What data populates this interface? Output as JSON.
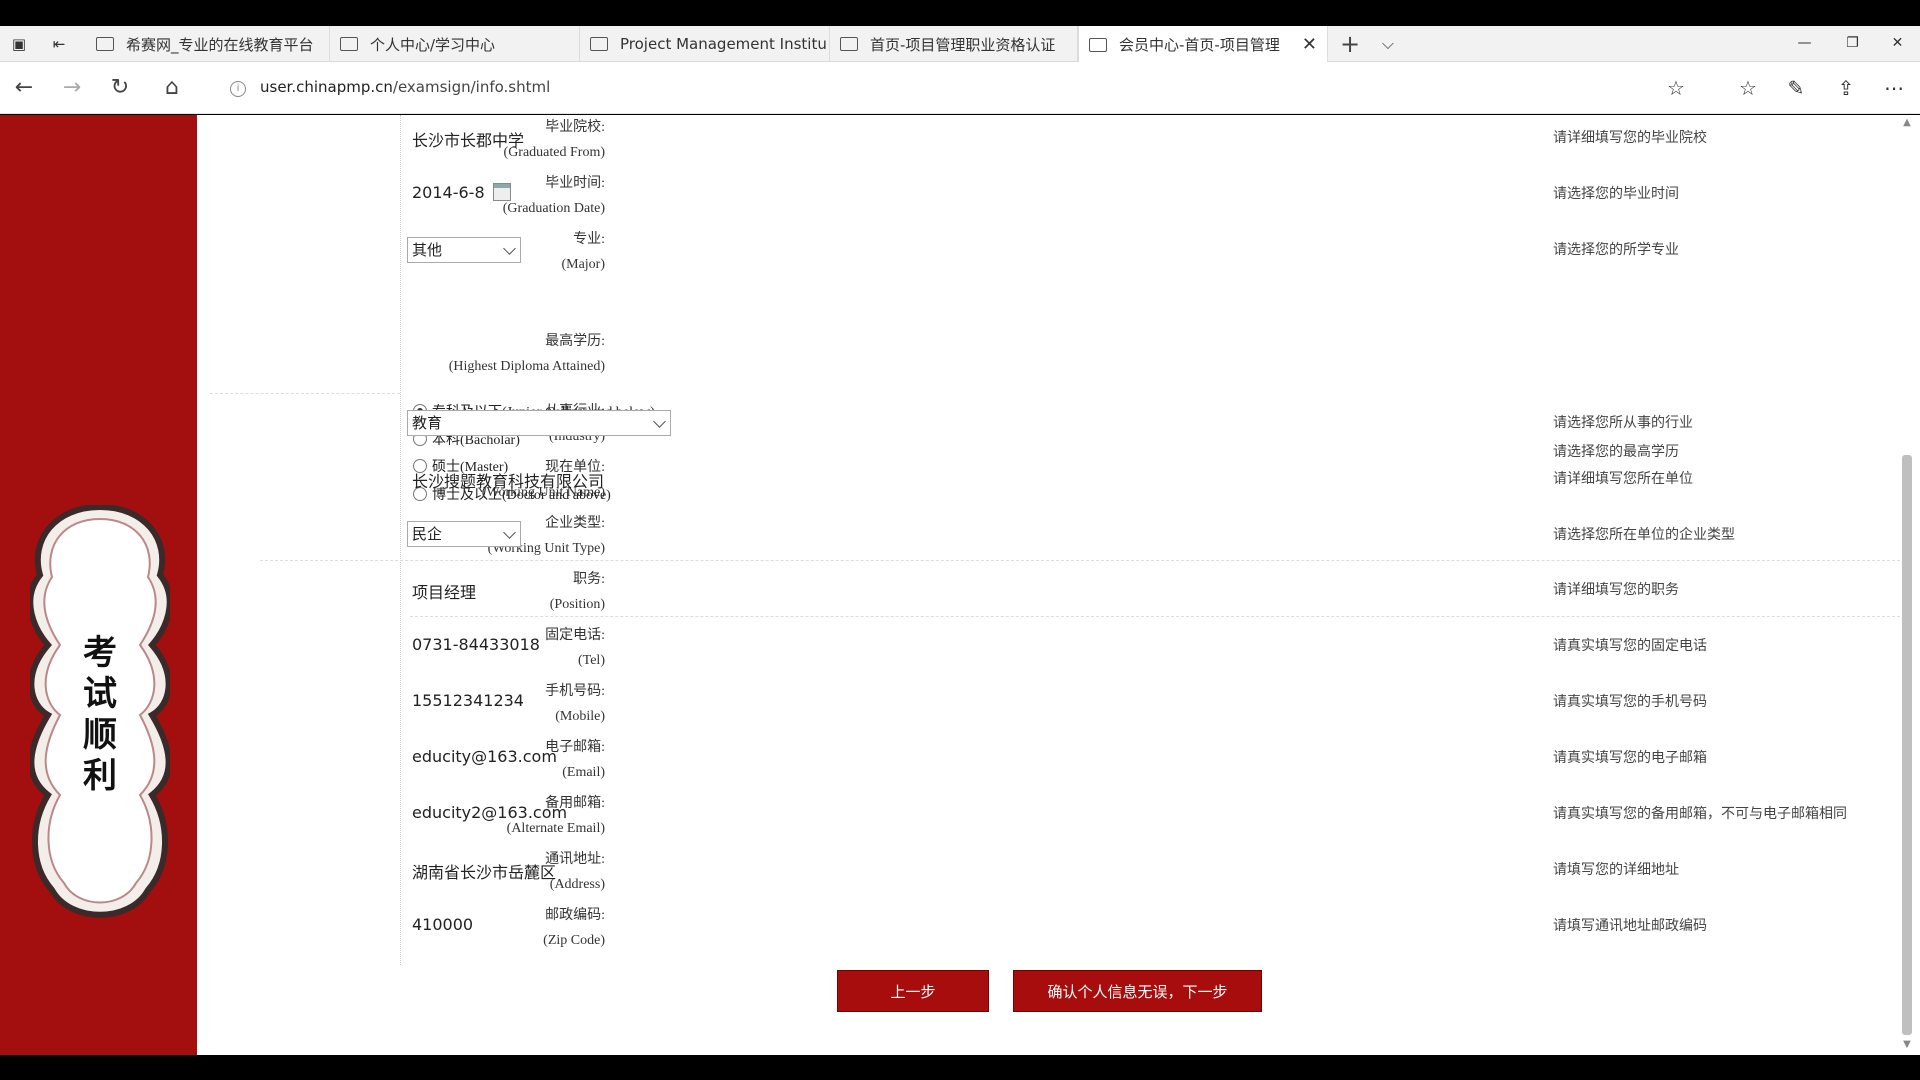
{
  "browser": {
    "tabs": [
      {
        "label": "希赛网_专业的在线教育平台"
      },
      {
        "label": "个人中心/学习中心"
      },
      {
        "label": "Project Management Institu"
      },
      {
        "label": "首页-项目管理职业资格认证"
      },
      {
        "label": "会员中心-首页-项目管理"
      }
    ],
    "new_tab": "+",
    "url_host": "user.chinapmp.cn",
    "url_path": "/examsign/info.shtml"
  },
  "sidebar": {
    "badge_chars": [
      "考",
      "试",
      "顺",
      "利"
    ],
    "brand_color": "#a30e0e"
  },
  "form": {
    "school": {
      "label_cn": "毕业院校:",
      "label_en": "(Graduated From)",
      "value": "长沙市长郡中学",
      "hint": "请详细填写您的毕业院校"
    },
    "grad_date": {
      "label_cn": "毕业时间:",
      "label_en": "(Graduation Date)",
      "value": "2014-6-8",
      "hint": "请选择您的毕业时间"
    },
    "major": {
      "label_cn": "专业:",
      "label_en": "(Major)",
      "value": "其他",
      "hint": "请选择您的所学专业"
    },
    "diploma": {
      "label_cn": "最高学历:",
      "label_en": "(Highest Diploma Attained)",
      "options": [
        "专科及以下(Junior College and below)",
        "本科(Bacholar)",
        "硕士(Master)",
        "博士及以上(Doctor and above)"
      ],
      "selected_index": 0,
      "hint": "请选择您的最高学历"
    },
    "industry": {
      "label_cn": "从事行业:",
      "label_en": "(Industry)",
      "value": "教育",
      "hint": "请选择您所从事的行业"
    },
    "work_unit": {
      "label_cn": "现在单位:",
      "label_en": "(Working Unit Name)",
      "value": "长沙搜题教育科技有限公司",
      "hint": "请详细填写您所在单位"
    },
    "unit_type": {
      "label_cn": "企业类型:",
      "label_en": "(Working Unit Type)",
      "value": "民企",
      "hint": "请选择您所在单位的企业类型"
    },
    "position": {
      "label_cn": "职务:",
      "label_en": "(Position)",
      "value": "项目经理",
      "hint": "请详细填写您的职务"
    },
    "tel": {
      "label_cn": "固定电话:",
      "label_en": "(Tel)",
      "value": "0731-84433018",
      "hint": "请真实填写您的固定电话"
    },
    "mobile": {
      "label_cn": "手机号码:",
      "label_en": "(Mobile)",
      "value": "15512341234",
      "hint": "请真实填写您的手机号码"
    },
    "email": {
      "label_cn": "电子邮箱:",
      "label_en": "(Email)",
      "value": "educity@163.com",
      "hint": "请真实填写您的电子邮箱"
    },
    "alt_email": {
      "label_cn": "备用邮箱:",
      "label_en": "(Alternate Email)",
      "value": "educity2@163.com",
      "hint": "请真实填写您的备用邮箱，不可与电子邮箱相同"
    },
    "address": {
      "label_cn": "通讯地址:",
      "label_en": "(Address)",
      "value": "湖南省长沙市岳麓区",
      "hint": "请填写您的详细地址"
    },
    "zip": {
      "label_cn": "邮政编码:",
      "label_en": "(Zip Code)",
      "value": "410000",
      "hint": "请填写通讯地址邮政编码"
    }
  },
  "buttons": {
    "prev": "上一步",
    "next": "确认个人信息无误，下一步"
  }
}
